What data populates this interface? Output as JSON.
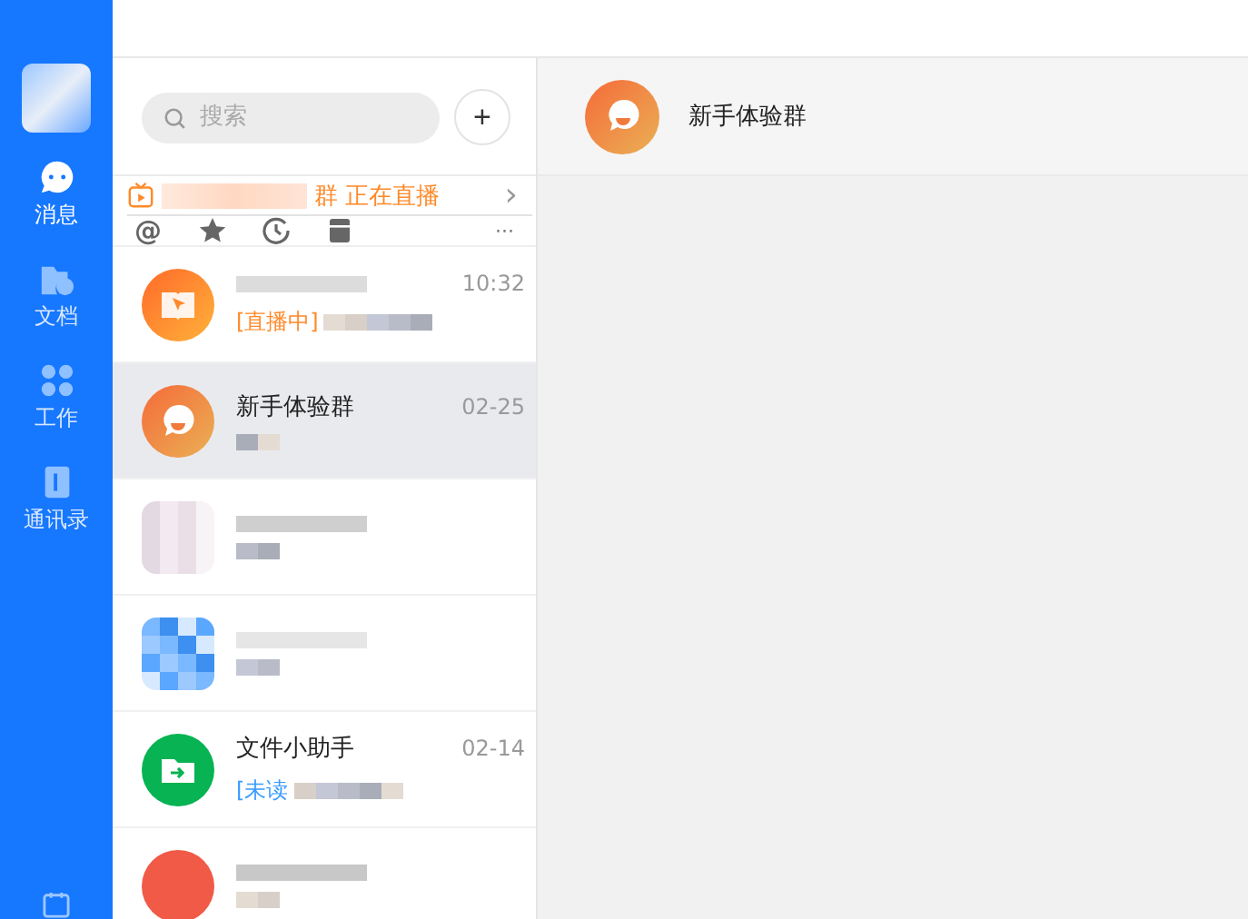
{
  "sidebar": {
    "items": [
      {
        "label": "消息",
        "kind": "chat",
        "selected": true
      },
      {
        "label": "文档",
        "kind": "folder",
        "selected": false
      },
      {
        "label": "工作",
        "kind": "grid",
        "selected": false
      },
      {
        "label": "通讯录",
        "kind": "contacts",
        "selected": false
      }
    ]
  },
  "search": {
    "placeholder": "搜索",
    "add_label": "+"
  },
  "live_banner": {
    "text": "群 正在直播",
    "arrow": "›"
  },
  "filters": {
    "at": "@",
    "more": "···"
  },
  "chats": [
    {
      "kind": "book",
      "time": "10:32",
      "tag": "[直播中]",
      "color": "#ff8a2a",
      "selected": false
    },
    {
      "kind": "hi",
      "name": "新手体验群",
      "time": "02-25",
      "selected": true
    },
    {
      "kind": "mosaic-pink",
      "selected": false
    },
    {
      "kind": "mosaic-blue",
      "selected": false
    },
    {
      "kind": "file",
      "name": "文件小助手",
      "time": "02-14",
      "tag": "[未读",
      "color": "#3a9bff",
      "selected": false
    },
    {
      "kind": "red",
      "selected": false
    }
  ],
  "chat_header": {
    "title": "新手体验群"
  }
}
